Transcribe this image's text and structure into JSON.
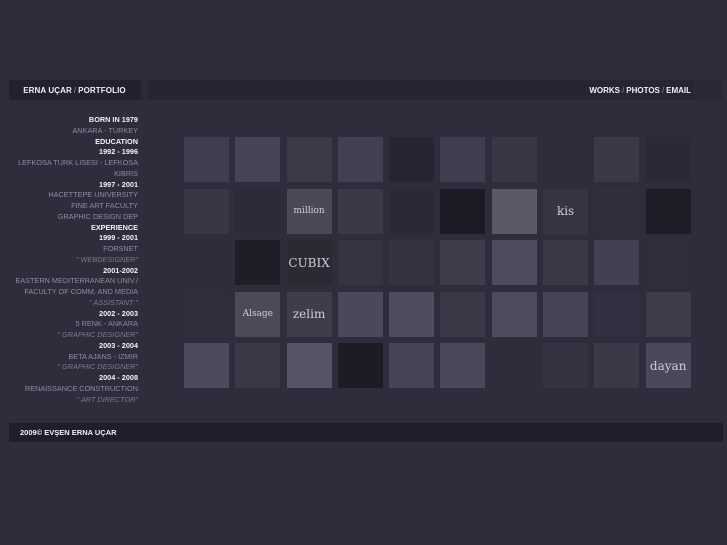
{
  "header": {
    "brand_name": "ERNA UÇAR",
    "brand_sep": "/",
    "brand_section": "PORTFOLIO",
    "nav": [
      {
        "label": "WORKS"
      },
      {
        "label": "PHOTOS"
      },
      {
        "label": "EMAIL"
      }
    ],
    "nav_sep": "/"
  },
  "bio": [
    {
      "text": "BORN IN 1979",
      "style": "h"
    },
    {
      "text": "ANKARA - TURKEY",
      "style": "n"
    },
    {
      "text": "EDUCATION",
      "style": "h"
    },
    {
      "text": "1992 - 1996",
      "style": "h"
    },
    {
      "text": "LEFKOSA TURK LISESI - LEFKOSA",
      "style": "n"
    },
    {
      "text": "KIBRIS",
      "style": "n"
    },
    {
      "text": "1997 - 2001",
      "style": "h"
    },
    {
      "text": "HACETTEPE UNIVERSITY",
      "style": "n"
    },
    {
      "text": "FINE ART FACULTY",
      "style": "n"
    },
    {
      "text": "GRAPHIC DESIGN DEP",
      "style": "n"
    },
    {
      "text": "EXPERIENCE",
      "style": "h"
    },
    {
      "text": "1999 - 2001",
      "style": "h"
    },
    {
      "text": "FORSNET",
      "style": "n"
    },
    {
      "text": "\" WEBDESIGNER\"",
      "style": "q"
    },
    {
      "text": "2001-2002",
      "style": "h"
    },
    {
      "text": "EASTERN MEDITERRANEAN UNIV./",
      "style": "n"
    },
    {
      "text": "FACULTY OF COMM. AND MEDIA",
      "style": "n"
    },
    {
      "text": "\" ASSISTANT \"",
      "style": "q"
    },
    {
      "text": "2002 - 2003",
      "style": "h"
    },
    {
      "text": "5 RENK - ANKARA",
      "style": "n"
    },
    {
      "text": "\" GRAPHIC DESIGNER\"",
      "style": "q"
    },
    {
      "text": "2003 - 2004",
      "style": "h"
    },
    {
      "text": "BETA AJANS - IZMIR",
      "style": "n"
    },
    {
      "text": "\" GRAPHIC DESIGNER\"",
      "style": "q"
    },
    {
      "text": "2004 - 2008",
      "style": "h"
    },
    {
      "text": "RENAISSANCE CONSTRUCTION",
      "style": "n"
    },
    {
      "text": "\" ART DIRECTOR\"",
      "style": "q"
    }
  ],
  "thumbnails": [
    {
      "color": "#3f3e4e",
      "text": ""
    },
    {
      "color": "#454456",
      "text": ""
    },
    {
      "color": "#3b3a47",
      "text": ""
    },
    {
      "color": "#414052",
      "text": ""
    },
    {
      "color": "#262532",
      "text": ""
    },
    {
      "color": "#3f3e4f",
      "text": ""
    },
    {
      "color": "#383746",
      "text": ""
    },
    {
      "color": "#2d2c38",
      "text": ""
    },
    {
      "color": "#3a3948",
      "text": ""
    },
    {
      "color": "#2a2935",
      "text": ""
    },
    {
      "color": "#383746",
      "text": ""
    },
    {
      "color": "#2c2b37",
      "text": ""
    },
    {
      "color": "#4a4958",
      "text": "million"
    },
    {
      "color": "#3a3948",
      "text": ""
    },
    {
      "color": "#2a2935",
      "text": ""
    },
    {
      "color": "#1c1b25",
      "text": ""
    },
    {
      "color": "#5a5968",
      "text": ""
    },
    {
      "color": "#363544",
      "text": "kis"
    },
    {
      "color": "#302f3d",
      "text": ""
    },
    {
      "color": "#1e1d27",
      "text": ""
    },
    {
      "color": "#2d2c39",
      "text": ""
    },
    {
      "color": "#1f1e28",
      "text": ""
    },
    {
      "color": "#2a2934",
      "text": "CUBIX"
    },
    {
      "color": "#353443",
      "text": ""
    },
    {
      "color": "#343342",
      "text": ""
    },
    {
      "color": "#3e3d4c",
      "text": ""
    },
    {
      "color": "#4d4c5c",
      "text": ""
    },
    {
      "color": "#3a3948",
      "text": ""
    },
    {
      "color": "#424152",
      "text": ""
    },
    {
      "color": "#2f2e3b",
      "text": ""
    },
    {
      "color": "#2f2e3a",
      "text": ""
    },
    {
      "color": "#4b4a58",
      "text": "Alsage"
    },
    {
      "color": "#3e3d4a",
      "text": "zelim"
    },
    {
      "color": "#4a4959",
      "text": ""
    },
    {
      "color": "#4e4d5e",
      "text": ""
    },
    {
      "color": "#3a3947",
      "text": ""
    },
    {
      "color": "#4d4c5d",
      "text": ""
    },
    {
      "color": "#464556",
      "text": ""
    },
    {
      "color": "#303040",
      "text": ""
    },
    {
      "color": "#3d3c4b",
      "text": ""
    },
    {
      "color": "#4c4b5b",
      "text": ""
    },
    {
      "color": "#3a3947",
      "text": ""
    },
    {
      "color": "#555466",
      "text": ""
    },
    {
      "color": "#1d1c25",
      "text": ""
    },
    {
      "color": "#464555",
      "text": ""
    },
    {
      "color": "#4a495a",
      "text": ""
    },
    {
      "color": "#2e2d39",
      "text": ""
    },
    {
      "color": "#343342",
      "text": ""
    },
    {
      "color": "#3a3948",
      "text": ""
    },
    {
      "color": "#4a4959",
      "text": "dayan"
    }
  ],
  "footer": {
    "copyright": "2009© EVŞEN ERNA UÇAR"
  }
}
